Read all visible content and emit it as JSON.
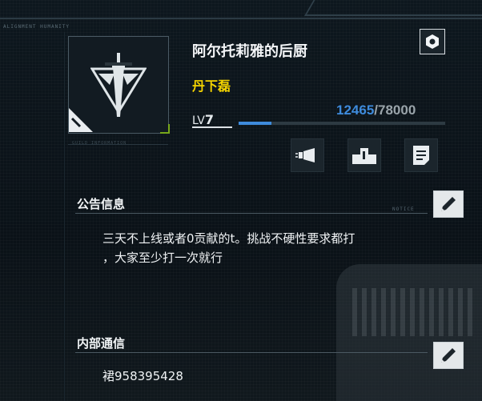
{
  "frame": {
    "label": "ALIGNMENT  HUMANITY"
  },
  "guild": {
    "name": "阿尔托莉雅的后厨",
    "leader": "丹下磊",
    "level_prefix": "LV",
    "level": "7",
    "exp_current": "12465",
    "exp_separator": "/",
    "exp_max": "78000",
    "exp_fraction": 0.16,
    "info_caption": "GUILD INFORMATION"
  },
  "actions": [
    {
      "icon": "megaphone-icon"
    },
    {
      "icon": "podium-icon"
    },
    {
      "icon": "document-icon"
    }
  ],
  "notice": {
    "title": "公告信息",
    "tag": "NOTICE",
    "lines": [
      "三天不上线或者0贡献的t。挑战不硬性要求都打",
      "，大家至少打一次就行"
    ]
  },
  "internal": {
    "title": "内部通信",
    "text": "裙958395428"
  },
  "colors": {
    "leader": "#f5d400",
    "exp_current": "#3e8bdc",
    "accent_bracket": "#78a81a"
  }
}
